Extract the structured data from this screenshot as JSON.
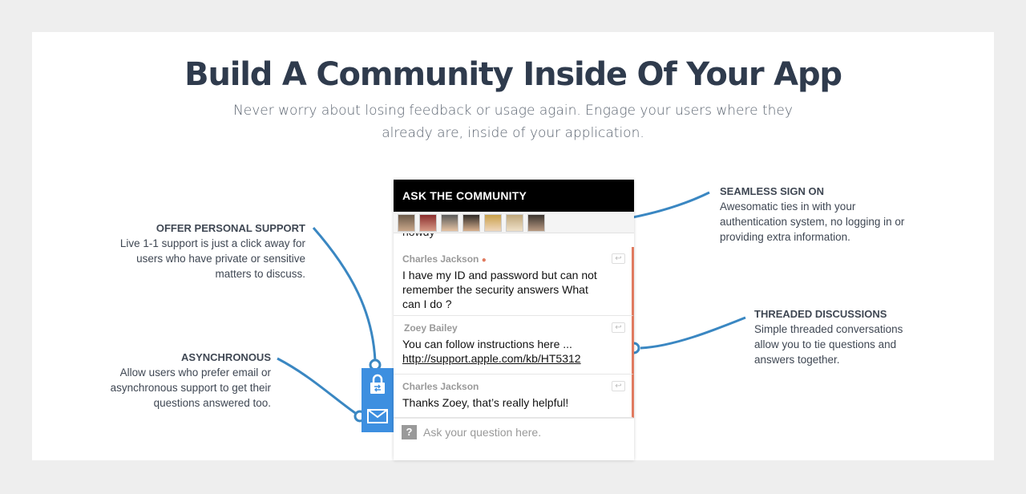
{
  "header": {
    "title": "Build A Community Inside Of Your App",
    "subtitle": "Never worry about losing feedback or usage again. Engage your users where they already are, inside of your application."
  },
  "callouts": {
    "personal_support": {
      "title": "OFFER PERSONAL SUPPORT",
      "body": "Live 1-1 support is just a click away for users who have private or sensitive matters to discuss."
    },
    "asynchronous": {
      "title": "ASYNCHRONOUS",
      "body": "Allow users who prefer email or asynchronous support to get their questions answered too."
    },
    "sign_on": {
      "title": "SEAMLESS SIGN ON",
      "body": "Awesomatic ties in with your authentication system, no logging in or providing extra information."
    },
    "threaded": {
      "title": "THREADED DISCUSSIONS",
      "body": "Simple threaded conversations allow you to tie questions and answers together."
    }
  },
  "widget": {
    "title": "ASK THE COMMUNITY",
    "cut_text": "howdy",
    "messages": [
      {
        "author": "Charles Jackson",
        "online_dot": "●",
        "text": "I have my ID and password but can not remember the security answers  What can I do ?"
      },
      {
        "author": "Zoey Bailey",
        "text": "You can follow instructions here ...",
        "link": "http://support.apple.com/kb/HT5312"
      },
      {
        "author": "Charles Jackson",
        "text": "Thanks Zoey, that’s really helpful!"
      }
    ],
    "reply_icon": "↩",
    "ask_icon": "?",
    "ask_placeholder": "Ask your question here."
  },
  "colors": {
    "accent_blue": "#3d8fe0",
    "line_blue": "#3a87c2",
    "thread_orange": "#e07a5f"
  },
  "icons": {
    "lock": "lock-icon",
    "mail": "mail-icon"
  }
}
